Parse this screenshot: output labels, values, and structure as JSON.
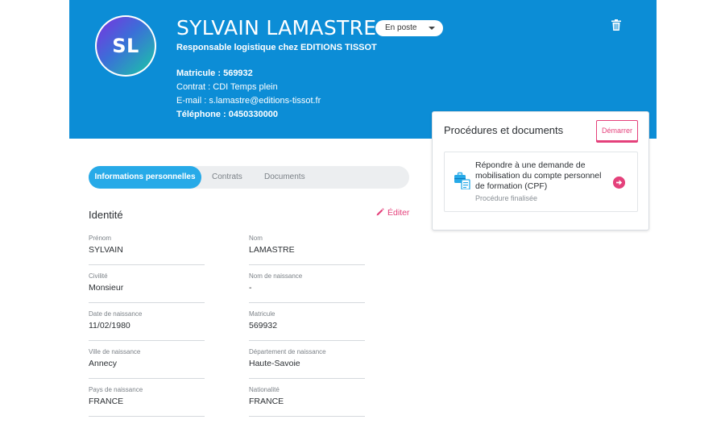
{
  "profile": {
    "initials": "SL",
    "name": "SYLVAIN LAMASTRE",
    "status": "En poste",
    "job": "Responsable logistique chez EDITIONS TISSOT",
    "matricule_label": "Matricule :",
    "matricule": "569932",
    "contrat_label": "Contrat :",
    "contrat": "CDI Temps plein",
    "email_label": "E-mail :",
    "email": "s.lamastre@editions-tissot.fr",
    "phone_label": "Téléphone :",
    "phone": "0450330000"
  },
  "procedures": {
    "title": "Procédures et documents",
    "start_label": "Démarrer",
    "card_title": "Répondre à une demande de mobilisation du compte personnel de formation (CPF)",
    "card_status": "Procédure finalisée"
  },
  "tabs": [
    {
      "label": "Informations personnelles"
    },
    {
      "label": "Contrats"
    },
    {
      "label": "Documents"
    }
  ],
  "identity": {
    "title": "Identité",
    "edit_label": "Éditer",
    "fields": [
      {
        "label": "Prénom",
        "value": "SYLVAIN"
      },
      {
        "label": "Nom",
        "value": "LAMASTRE"
      },
      {
        "label": "Civilité",
        "value": "Monsieur"
      },
      {
        "label": "Nom de naissance",
        "value": "-"
      },
      {
        "label": "Date de naissance",
        "value": "11/02/1980"
      },
      {
        "label": "Matricule",
        "value": "569932"
      },
      {
        "label": "Ville de naissance",
        "value": "Annecy"
      },
      {
        "label": "Département de naissance",
        "value": "Haute-Savoie"
      },
      {
        "label": "Pays de naissance",
        "value": "FRANCE"
      },
      {
        "label": "Nationalité",
        "value": "FRANCE"
      }
    ]
  },
  "colors": {
    "header": "#0c8dd6",
    "accent": "#e4417b",
    "tab_active": "#27aae8"
  },
  "icons": [
    "trash-icon",
    "pencil-icon",
    "briefcase-document-icon",
    "arrow-right-circle-icon",
    "chevron-down-icon"
  ]
}
